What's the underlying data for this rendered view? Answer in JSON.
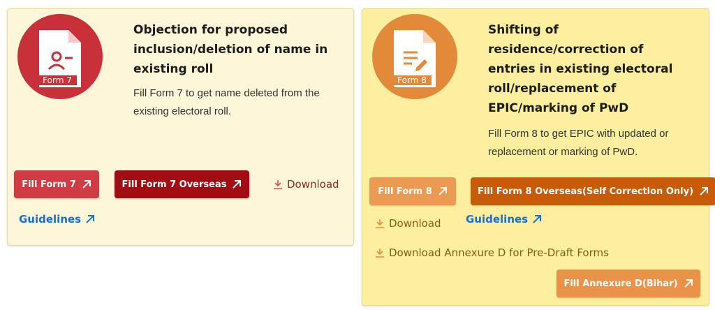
{
  "form7": {
    "badge": "Form 7",
    "title": "Objection for proposed inclusion/deletion of name in existing roll",
    "description": "Fill Form 7 to get name deleted from the existing electoral roll.",
    "fill_label": "Fill Form 7",
    "overseas_label": "Fill Form 7 Overseas",
    "download_label": "Download",
    "guidelines_label": "Guidelines",
    "color": "#c8313a"
  },
  "form8": {
    "badge": "Form 8",
    "title": "Shifting of residence/correction of entries in existing electoral roll/replacement of EPIC/marking of PwD",
    "description": "Fill Form 8 to get EPIC with updated or replacement or marking of PwD.",
    "fill_label": "Fill Form 8",
    "overseas_label": "Fill Form 8 Overseas(Self Correction Only)",
    "download_label": "Download",
    "guidelines_label": "Guidelines",
    "annexure_download_label": "Download Annexure D for Pre-Draft Forms",
    "annexure_bihar_label": "Fill Annexure D(Bihar)",
    "color": "#e28a3a"
  },
  "icons": {
    "form7_icon": "person-remove-document-icon",
    "form8_icon": "edit-document-icon",
    "external": "arrow-up-right-icon",
    "download": "download-icon"
  }
}
